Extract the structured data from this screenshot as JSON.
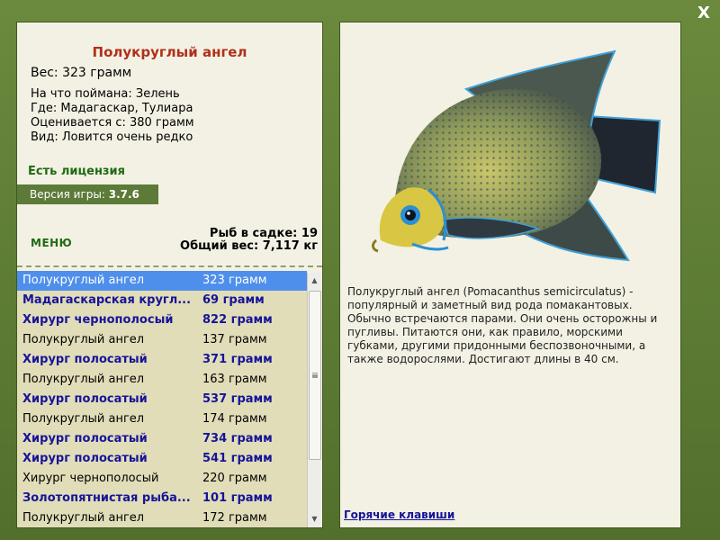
{
  "close_label": "X",
  "fish": {
    "title": "Полукруглый ангел",
    "weight": "Вес: 323 грамм",
    "caught_on": "На что поймана: Зелень",
    "where": "Где: Мадагаскар, Тулиара",
    "valued_from": "Оценивается с: 380 грамм",
    "rarity": "Вид: Ловится очень редко"
  },
  "license": "Есть лицензия",
  "version_label": "Версия игры:",
  "version_value": "3.7.6",
  "menu_label": "МЕНЮ",
  "stats": {
    "cage": "Рыб в садке: 19",
    "total": "Общий вес: 7,117 кг"
  },
  "catch_list": [
    {
      "name": "Полукруглый ангел",
      "weight": "323 грамм",
      "rare": false,
      "selected": true
    },
    {
      "name": "Мадагаскарская кругл...",
      "weight": "69 грамм",
      "rare": true,
      "selected": false
    },
    {
      "name": "Хирург чернополосый",
      "weight": "822 грамм",
      "rare": true,
      "selected": false
    },
    {
      "name": "Полукруглый ангел",
      "weight": "137 грамм",
      "rare": false,
      "selected": false
    },
    {
      "name": "Хирург полосатый",
      "weight": "371 грамм",
      "rare": true,
      "selected": false
    },
    {
      "name": "Полукруглый ангел",
      "weight": "163 грамм",
      "rare": false,
      "selected": false
    },
    {
      "name": "Хирург полосатый",
      "weight": "537 грамм",
      "rare": true,
      "selected": false
    },
    {
      "name": "Полукруглый ангел",
      "weight": "174 грамм",
      "rare": false,
      "selected": false
    },
    {
      "name": "Хирург полосатый",
      "weight": "734 грамм",
      "rare": true,
      "selected": false
    },
    {
      "name": "Хирург полосатый",
      "weight": "541 грамм",
      "rare": true,
      "selected": false
    },
    {
      "name": "Хирург чернополосый",
      "weight": "220 грамм",
      "rare": false,
      "selected": false
    },
    {
      "name": "Золотопятнистая рыба...",
      "weight": "101 грамм",
      "rare": true,
      "selected": false
    },
    {
      "name": "Полукруглый ангел",
      "weight": "172 грамм",
      "rare": false,
      "selected": false
    }
  ],
  "description": "Полукруглый ангел (Pomacanthus semicirculatus) - популярный и заметный вид рода помакантовых. Обычно встречаются парами. Они очень осторожны и пугливы. Питаются они, как правило, морскими губками, другими придонными беспозвоночными, а также водорослями. Достигают длины в 40 см.",
  "hotkeys_label": "Горячие клавиши",
  "colors": {
    "frame": "#5b7a33",
    "panel": "#f3f1e4",
    "title": "#b0301a",
    "rare_text": "#16149a",
    "selection": "#4f8fec"
  }
}
